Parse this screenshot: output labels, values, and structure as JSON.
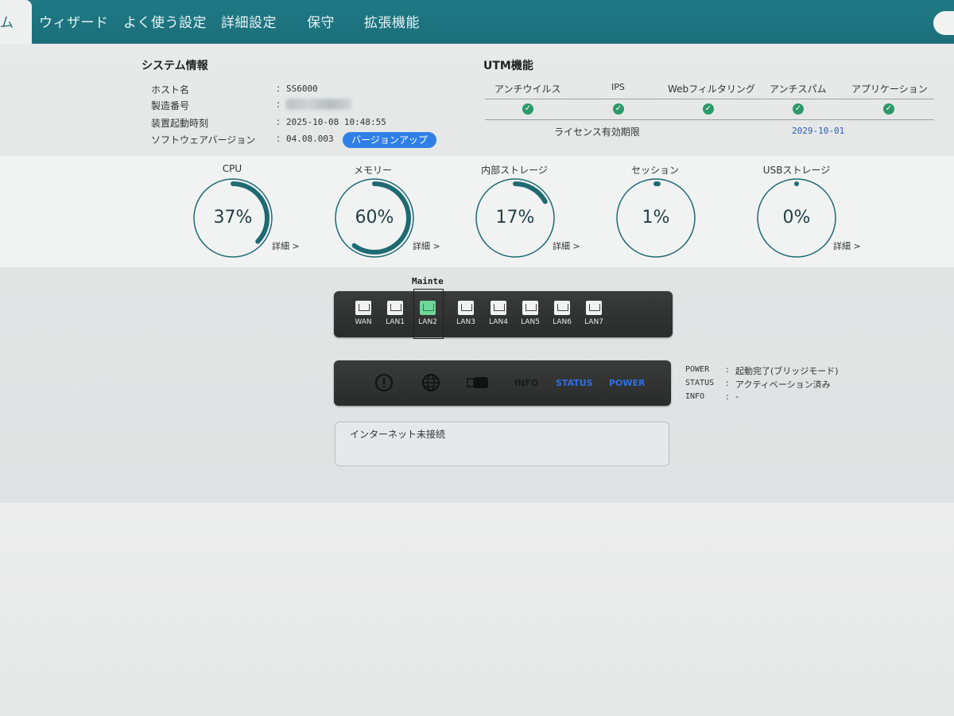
{
  "nav": {
    "tabs": [
      {
        "label": "ム"
      },
      {
        "label": "ウィザード"
      },
      {
        "label": "よく使う設定"
      },
      {
        "label": "詳細設定"
      },
      {
        "label": "保守"
      },
      {
        "label": "拡張機能"
      }
    ]
  },
  "system_info": {
    "title": "システム情報",
    "rows": [
      {
        "label": "ホスト名",
        "value": "SS6000"
      },
      {
        "label": "製造番号",
        "value": ""
      },
      {
        "label": "装置起動時刻",
        "value": "2025-10-08 10:48:55"
      },
      {
        "label": "ソフトウェアバージョン",
        "value": "04.08.003"
      }
    ],
    "colon": ":",
    "upgrade_label": "バージョンアップ"
  },
  "utm": {
    "title": "UTM機能",
    "columns": [
      "アンチウイルス",
      "IPS",
      "Webフィルタリング",
      "アンチスパム",
      "アプリケーション"
    ],
    "check_glyph": "✓",
    "license_label": "ライセンス有効期限",
    "license_value": "2029-10-01"
  },
  "gauges": [
    {
      "title": "CPU",
      "percent": 37,
      "value": "37%",
      "detail": "詳細 >"
    },
    {
      "title": "メモリー",
      "percent": 60,
      "value": "60%",
      "detail": "詳細 >"
    },
    {
      "title": "内部ストレージ",
      "percent": 17,
      "value": "17%",
      "detail": "詳細 >"
    },
    {
      "title": "セッション",
      "percent": 1,
      "value": "1%",
      "detail": ""
    },
    {
      "title": "USBストレージ",
      "percent": 0,
      "value": "0%",
      "detail": "詳細 >"
    }
  ],
  "ports": {
    "mainte_label": "Mainte",
    "items": [
      "WAN",
      "LAN1",
      "LAN2",
      "LAN3",
      "LAN4",
      "LAN5",
      "LAN6",
      "LAN7"
    ],
    "active": "LAN2"
  },
  "leds": {
    "info_label": "INFO",
    "status_label": "STATUS",
    "power_label": "POWER",
    "colors": {
      "info": "#1a1a1a",
      "status": "#2f6fe0",
      "power": "#2f6fe0"
    }
  },
  "status_lines": [
    {
      "key": "POWER",
      "value": "起動完了(ブリッジモード)"
    },
    {
      "key": "STATUS",
      "value": "アクティベーション済み"
    },
    {
      "key": "INFO",
      "value": "-"
    }
  ],
  "status_colon": ":",
  "message": "インターネット未接続",
  "colors": {
    "nav": "#1f7a86",
    "gauge_arc": "#1e6a73",
    "check": "#2c9a6a",
    "upgrade": "#2f7fe6"
  }
}
